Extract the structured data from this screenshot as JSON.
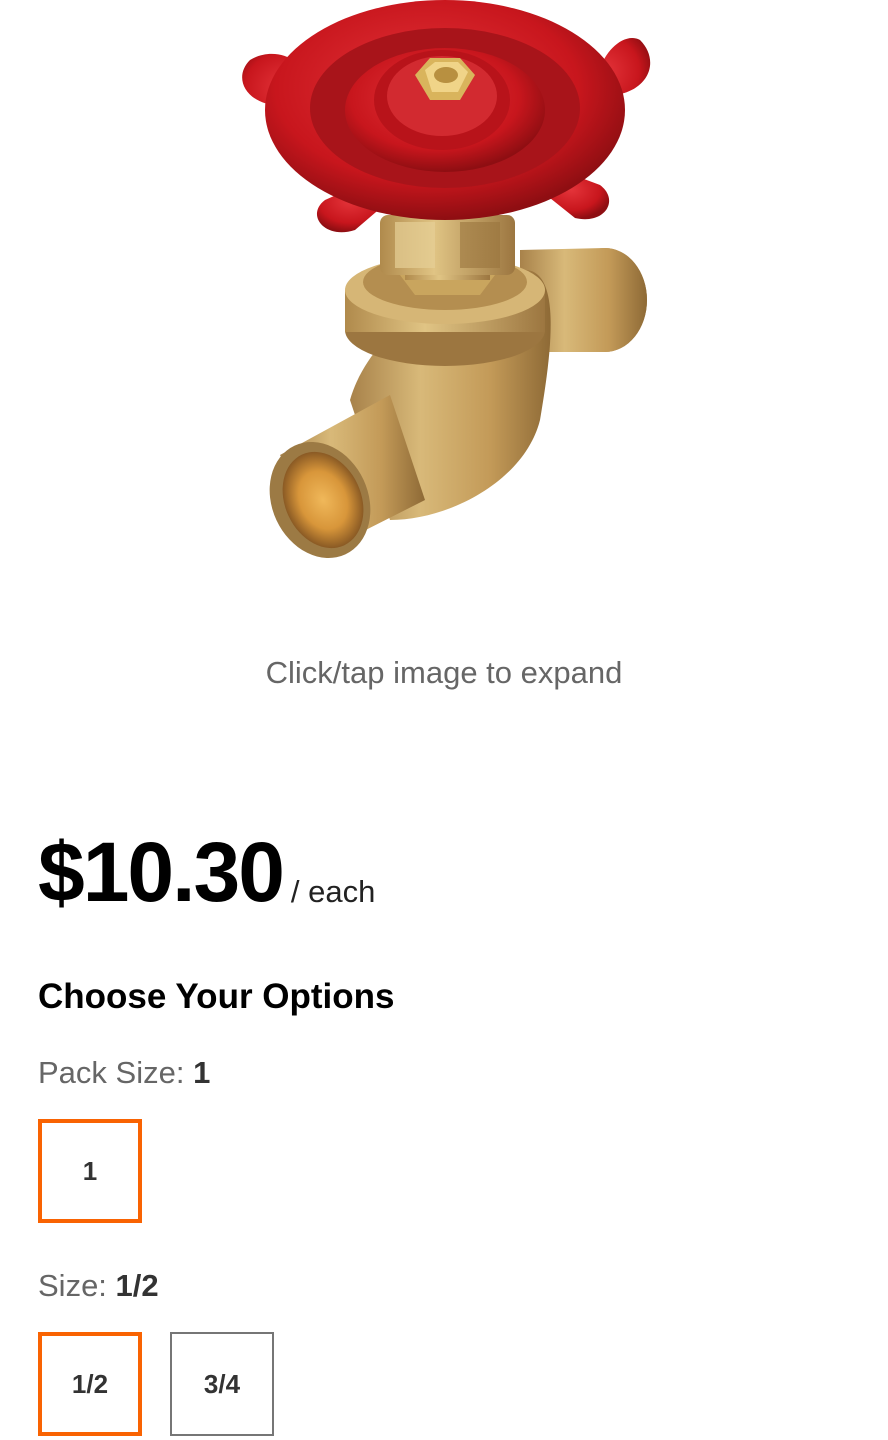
{
  "product": {
    "image_alt": "brass gate valve with red handwheel",
    "expand_hint": "Click/tap image to expand"
  },
  "pricing": {
    "price": "$10.30",
    "unit": "/ each"
  },
  "options": {
    "title": "Choose Your Options",
    "pack_size": {
      "label": "Pack Size:",
      "selected": "1",
      "choices": [
        "1"
      ]
    },
    "size": {
      "label": "Size:",
      "selected": "1/2",
      "choices": [
        "1/2",
        "3/4"
      ]
    }
  },
  "colors": {
    "accent": "#f96302",
    "handle_red": "#c8161d",
    "brass": "#c8a45e"
  }
}
